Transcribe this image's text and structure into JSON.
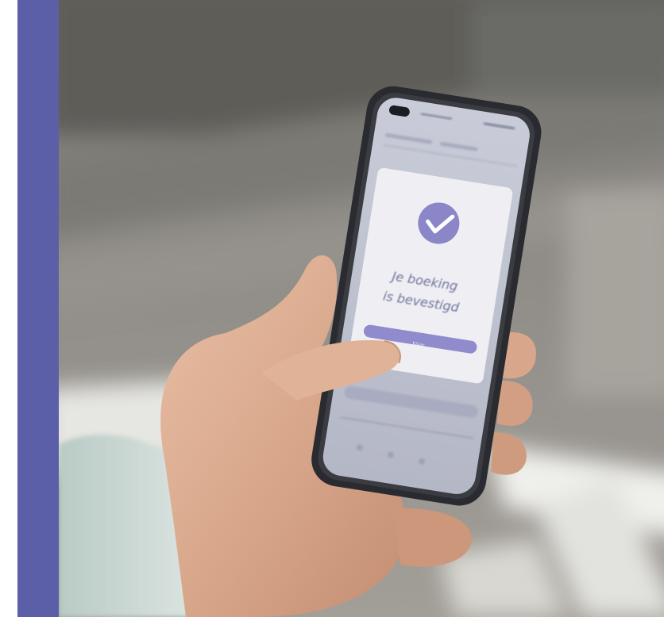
{
  "colors": {
    "accent": "#5b5fa8",
    "dialog_accent": "#8a86c8",
    "background_road": "#8c8a86"
  },
  "dialog": {
    "icon": "check-circle-icon",
    "message_line1": "Je boeking",
    "message_line2": "is bevestigd",
    "button_label": "Klaar"
  }
}
